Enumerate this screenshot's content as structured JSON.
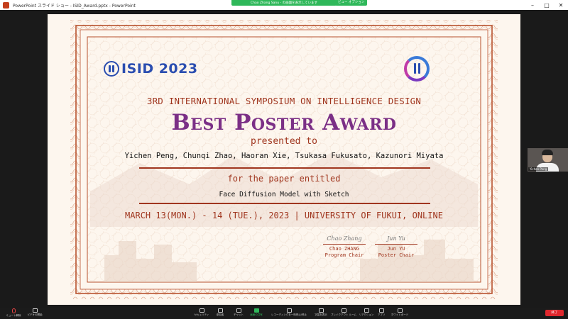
{
  "window": {
    "title": "PowerPoint スライド ショー - ISID_Award.pptx - PowerPoint",
    "share_banner": "Chao Zhang Sanu - の画面を表示しています",
    "view_options": "ビュー オプション",
    "controls": {
      "minimize": "–",
      "maximize": "□",
      "close": "✕"
    }
  },
  "certificate": {
    "logo_text": "ISID 2023",
    "symposium": "3RD INTERNATIONAL SYMPOSIUM ON INTELLIGENCE DESIGN",
    "award": "Best Poster Award",
    "presented_to": "presented to",
    "authors": "Yichen Peng, Chunqi Zhao, Haoran Xie, Tsukasa Fukusato, Kazunori Miyata",
    "for_paper": "for the paper entitled",
    "paper_title": "Face Diffusion Model with Sketch",
    "date_line": "MARCH 13(MON.) - 14 (TUE.), 2023 | UNIVERSITY OF FUKUI, ONLINE",
    "signatures": [
      {
        "signature": "Chao Zhang",
        "name": "Chao ZHANG",
        "role": "Program Chair"
      },
      {
        "signature": "Jun Yu",
        "name": "Jun YU",
        "role": "Poster Chair"
      }
    ],
    "colors": {
      "accent": "#a0361f",
      "award": "#7b2f86",
      "logo": "#2a4db0",
      "paper": "#fdf6ee"
    }
  },
  "participant": {
    "name": "Yichen Peng"
  },
  "toolbar": {
    "mute_label": "ミュート解除",
    "video_label": "ビデオの開始",
    "items": [
      "セキュリティ",
      "参加者",
      "チャット",
      "画面の共有",
      "レコーディングを一時停止/停止",
      "字幕を表示",
      "ブレイクアウト ルーム",
      "リアクション",
      "アプリ",
      "ホワイトボード"
    ],
    "participant_count": "3",
    "leave_label": "終了"
  }
}
